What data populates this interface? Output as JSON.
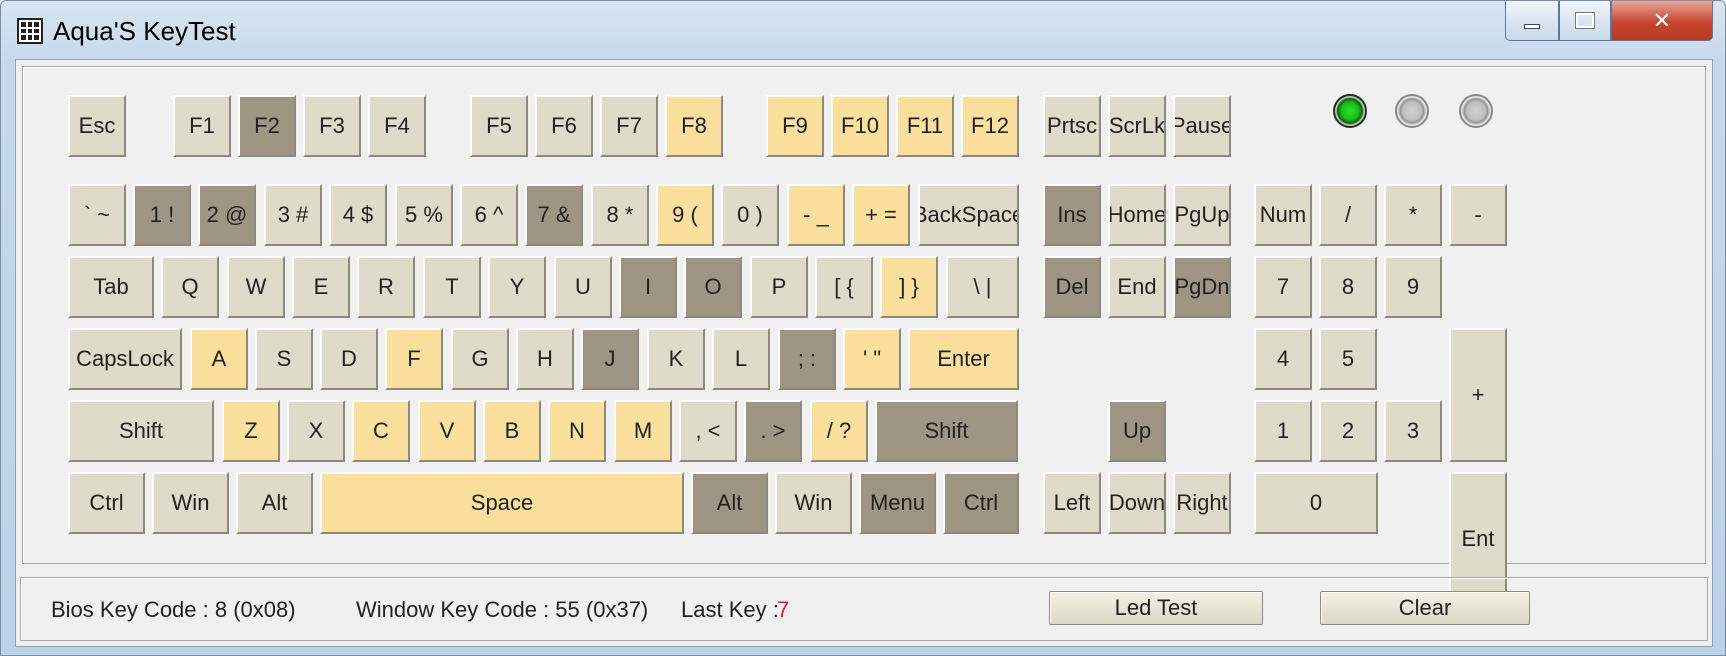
{
  "window": {
    "title": "Aqua'S KeyTest",
    "close_glyph": "✕"
  },
  "colors": {
    "key_normal": "#dedbc9",
    "key_pressed": "#fae09c",
    "key_held": "#9e9583",
    "led_on": "#13c213",
    "last_key_value": "#e02020"
  },
  "leds": [
    {
      "name": "led-1",
      "state": "on"
    },
    {
      "name": "led-2",
      "state": "off"
    },
    {
      "name": "led-3",
      "state": "off"
    }
  ],
  "keys": [
    {
      "label": "Esc",
      "state": "normal"
    },
    {
      "label": "F1",
      "state": "normal"
    },
    {
      "label": "F2",
      "state": "dark"
    },
    {
      "label": "F3",
      "state": "normal"
    },
    {
      "label": "F4",
      "state": "normal"
    },
    {
      "label": "F5",
      "state": "normal"
    },
    {
      "label": "F6",
      "state": "normal"
    },
    {
      "label": "F7",
      "state": "normal"
    },
    {
      "label": "F8",
      "state": "yellow"
    },
    {
      "label": "F9",
      "state": "yellow"
    },
    {
      "label": "F10",
      "state": "yellow"
    },
    {
      "label": "F11",
      "state": "yellow"
    },
    {
      "label": "F12",
      "state": "yellow"
    },
    {
      "label": "Prtsc",
      "state": "normal"
    },
    {
      "label": "ScrLk",
      "state": "normal"
    },
    {
      "label": "Pause",
      "state": "normal"
    },
    {
      "label": "` ~",
      "state": "normal"
    },
    {
      "label": "1 !",
      "state": "dark"
    },
    {
      "label": "2 @",
      "state": "dark"
    },
    {
      "label": "3 #",
      "state": "normal"
    },
    {
      "label": "4 $",
      "state": "normal"
    },
    {
      "label": "5 %",
      "state": "normal"
    },
    {
      "label": "6 ^",
      "state": "normal"
    },
    {
      "label": "7 &",
      "state": "dark"
    },
    {
      "label": "8 *",
      "state": "normal"
    },
    {
      "label": "9 (",
      "state": "yellow"
    },
    {
      "label": "0 )",
      "state": "normal"
    },
    {
      "label": "- _",
      "state": "yellow"
    },
    {
      "label": "+ =",
      "state": "yellow"
    },
    {
      "label": "BackSpace",
      "state": "normal"
    },
    {
      "label": "Ins",
      "state": "dark"
    },
    {
      "label": "Home",
      "state": "normal"
    },
    {
      "label": "PgUp",
      "state": "normal"
    },
    {
      "label": "Num",
      "state": "normal"
    },
    {
      "label": "/",
      "state": "normal"
    },
    {
      "label": "*",
      "state": "normal"
    },
    {
      "label": "-",
      "state": "normal"
    },
    {
      "label": "Tab",
      "state": "normal"
    },
    {
      "label": "Q",
      "state": "normal"
    },
    {
      "label": "W",
      "state": "normal"
    },
    {
      "label": "E",
      "state": "normal"
    },
    {
      "label": "R",
      "state": "normal"
    },
    {
      "label": "T",
      "state": "normal"
    },
    {
      "label": "Y",
      "state": "normal"
    },
    {
      "label": "U",
      "state": "normal"
    },
    {
      "label": "I",
      "state": "dark"
    },
    {
      "label": "O",
      "state": "dark"
    },
    {
      "label": "P",
      "state": "normal"
    },
    {
      "label": "[ {",
      "state": "normal"
    },
    {
      "label": "] }",
      "state": "yellow"
    },
    {
      "label": "\\ |",
      "state": "normal"
    },
    {
      "label": "Del",
      "state": "dark"
    },
    {
      "label": "End",
      "state": "normal"
    },
    {
      "label": "PgDn",
      "state": "dark"
    },
    {
      "label": "7",
      "state": "normal"
    },
    {
      "label": "8",
      "state": "normal"
    },
    {
      "label": "9",
      "state": "normal"
    },
    {
      "label": "+",
      "state": "normal"
    },
    {
      "label": "CapsLock",
      "state": "normal"
    },
    {
      "label": "A",
      "state": "yellow"
    },
    {
      "label": "S",
      "state": "normal"
    },
    {
      "label": "D",
      "state": "normal"
    },
    {
      "label": "F",
      "state": "yellow"
    },
    {
      "label": "G",
      "state": "normal"
    },
    {
      "label": "H",
      "state": "normal"
    },
    {
      "label": "J",
      "state": "dark"
    },
    {
      "label": "K",
      "state": "normal"
    },
    {
      "label": "L",
      "state": "normal"
    },
    {
      "label": "; :",
      "state": "dark"
    },
    {
      "label": "' \"",
      "state": "yellow"
    },
    {
      "label": "Enter",
      "state": "yellow"
    },
    {
      "label": "4",
      "state": "normal"
    },
    {
      "label": "5",
      "state": "normal"
    },
    {
      "label": "6",
      "state": "normal"
    },
    {
      "label": "Shift",
      "state": "normal"
    },
    {
      "label": "Z",
      "state": "yellow"
    },
    {
      "label": "X",
      "state": "normal"
    },
    {
      "label": "C",
      "state": "yellow"
    },
    {
      "label": "V",
      "state": "yellow"
    },
    {
      "label": "B",
      "state": "yellow"
    },
    {
      "label": "N",
      "state": "yellow"
    },
    {
      "label": "M",
      "state": "yellow"
    },
    {
      "label": ", <",
      "state": "normal"
    },
    {
      "label": ". >",
      "state": "dark"
    },
    {
      "label": "/ ?",
      "state": "yellow"
    },
    {
      "label": "Shift",
      "state": "dark"
    },
    {
      "label": "Up",
      "state": "dark"
    },
    {
      "label": "1",
      "state": "normal"
    },
    {
      "label": "2",
      "state": "normal"
    },
    {
      "label": "3",
      "state": "normal"
    },
    {
      "label": "Ent",
      "state": "normal"
    },
    {
      "label": "Ctrl",
      "state": "normal"
    },
    {
      "label": "Win",
      "state": "normal"
    },
    {
      "label": "Alt",
      "state": "normal"
    },
    {
      "label": "Space",
      "state": "yellow"
    },
    {
      "label": "Alt",
      "state": "dark"
    },
    {
      "label": "Win",
      "state": "normal"
    },
    {
      "label": "Menu",
      "state": "dark"
    },
    {
      "label": "Ctrl",
      "state": "dark"
    },
    {
      "label": "Left",
      "state": "normal"
    },
    {
      "label": "Down",
      "state": "normal"
    },
    {
      "label": "Right",
      "state": "normal"
    },
    {
      "label": "0",
      "state": "normal"
    },
    {
      "label": ".",
      "state": "normal"
    }
  ],
  "status": {
    "bios_key_code": "Bios Key Code : 8 (0x08)",
    "window_key_code": "Window Key Code : 55 (0x37)",
    "last_key_label": "Last Key :",
    "last_key_value": "7"
  },
  "buttons": {
    "led_test": "Led Test",
    "clear": "Clear"
  }
}
